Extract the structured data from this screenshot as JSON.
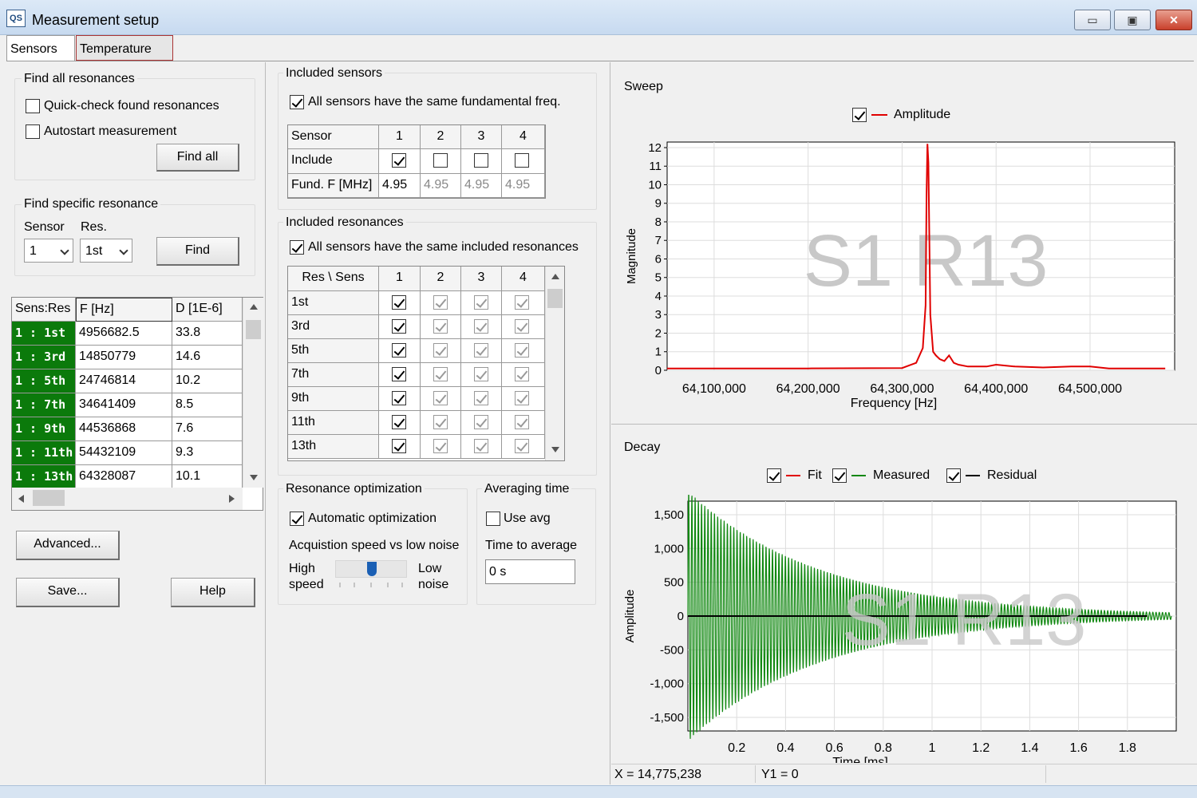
{
  "window": {
    "title": "Measurement setup",
    "icon": "QS",
    "minimize_label": "▭",
    "maximize_label": "▣",
    "close_label": "✕"
  },
  "tabs": [
    {
      "label": "Sensors"
    },
    {
      "label": "Temperature"
    }
  ],
  "find_all": {
    "title": "Find all resonances",
    "quick_check_label": "Quick-check found resonances",
    "quick_check": false,
    "autostart_label": "Autostart measurement",
    "autostart": false,
    "button": "Find all"
  },
  "find_specific": {
    "title": "Find specific resonance",
    "sensor_label": "Sensor",
    "res_label": "Res.",
    "sensor_value": "1",
    "res_value": "1st",
    "button": "Find"
  },
  "results": {
    "columns": [
      "Sens:Res",
      "F [Hz]",
      "D [1E-6]"
    ],
    "rows": [
      {
        "id": "1 : 1st",
        "f": "4956682.5",
        "d": "33.8"
      },
      {
        "id": "1 : 3rd",
        "f": "14850779",
        "d": "14.6"
      },
      {
        "id": "1 : 5th",
        "f": "24746814",
        "d": "10.2"
      },
      {
        "id": "1 : 7th",
        "f": "34641409",
        "d": "8.5"
      },
      {
        "id": "1 : 9th",
        "f": "44536868",
        "d": "7.6"
      },
      {
        "id": "1 : 11th",
        "f": "54432109",
        "d": "9.3"
      },
      {
        "id": "1 : 13th",
        "f": "64328087",
        "d": "10.1"
      }
    ]
  },
  "buttons": {
    "advanced": "Advanced...",
    "save": "Save...",
    "help": "Help"
  },
  "included_sensors": {
    "title": "Included sensors",
    "same_fund_label": "All sensors have the same fundamental freq.",
    "same_fund": true,
    "header": [
      "Sensor",
      "1",
      "2",
      "3",
      "4"
    ],
    "include_label": "Include",
    "include": [
      true,
      false,
      false,
      false
    ],
    "fund_label": "Fund. F [MHz]",
    "fund": [
      "4.95",
      "4.95",
      "4.95",
      "4.95"
    ]
  },
  "included_resonances": {
    "title": "Included resonances",
    "same_res_label": "All sensors have the same included resonances",
    "same_res": true,
    "header": [
      "Res \\ Sens",
      "1",
      "2",
      "3",
      "4"
    ],
    "rows": [
      "1st",
      "3rd",
      "5th",
      "7th",
      "9th",
      "11th",
      "13th"
    ]
  },
  "optimization": {
    "title": "Resonance optimization",
    "auto_label": "Automatic optimization",
    "auto": true,
    "speed_label": "Acquistion speed vs low noise",
    "high_label": "High speed",
    "low_label": "Low noise",
    "slider_level": 0.5
  },
  "averaging": {
    "title": "Averaging time",
    "use_avg_label": "Use avg",
    "use_avg": false,
    "time_label": "Time to average",
    "time_value": "0 s"
  },
  "colors": {
    "fit": "#e00000",
    "measured": "#118811",
    "residual": "#000000",
    "amplitude": "#e00000",
    "highlight": "#0b7a0b"
  },
  "sweep": {
    "title": "Sweep",
    "legend": "Amplitude",
    "watermark": "S1 R13",
    "ylabel": "Magnitude",
    "xlabel": "Frequency [Hz]",
    "yticks": [
      "0",
      "1",
      "2",
      "3",
      "4",
      "5",
      "6",
      "7",
      "8",
      "9",
      "10",
      "11",
      "12"
    ],
    "xticks": [
      "64,100,000",
      "64,200,000",
      "64,300,000",
      "64,400,000",
      "64,500,000"
    ]
  },
  "decay": {
    "title": "Decay",
    "legend_fit": "Fit",
    "legend_measured": "Measured",
    "legend_residual": "Residual",
    "watermark": "S1 R13",
    "ylabel": "Amplitude",
    "xlabel": "Time [ms]",
    "yticks": [
      "1,500",
      "1,000",
      "500",
      "0",
      "-500",
      "-1,000",
      "-1,500"
    ],
    "xticks": [
      "0.2",
      "0.4",
      "0.6",
      "0.8",
      "1",
      "1.2",
      "1.4",
      "1.6",
      "1.8"
    ]
  },
  "status": {
    "x": "X = 14,775,238",
    "y": "Y1 = 0"
  },
  "chart_data": [
    {
      "type": "line",
      "title": "Sweep",
      "xlabel": "Frequency [Hz]",
      "ylabel": "Magnitude",
      "xlim": [
        64050000,
        64590000
      ],
      "ylim": [
        0,
        12.3
      ],
      "series": [
        {
          "name": "Amplitude",
          "x": [
            64050000,
            64200000,
            64300000,
            64315000,
            64322000,
            64325000,
            64326000,
            64327000,
            64328000,
            64330000,
            64333000,
            64336000,
            64340000,
            64345000,
            64350000,
            64355000,
            64360000,
            64370000,
            64390000,
            64400000,
            64420000,
            64450000,
            64480000,
            64500000,
            64520000,
            64580000
          ],
          "y": [
            0.1,
            0.1,
            0.12,
            0.4,
            1.2,
            3.5,
            9.5,
            12.2,
            11.2,
            3.0,
            1.0,
            0.8,
            0.6,
            0.5,
            0.8,
            0.4,
            0.3,
            0.2,
            0.2,
            0.3,
            0.2,
            0.15,
            0.2,
            0.2,
            0.1,
            0.1
          ]
        }
      ]
    },
    {
      "type": "line",
      "title": "Decay",
      "xlabel": "Time [ms]",
      "ylabel": "Amplitude",
      "xlim": [
        0,
        2.0
      ],
      "ylim": [
        -1700,
        1700
      ],
      "series": [
        {
          "name": "Measured",
          "envelope_start": 1850,
          "envelope_end": 50,
          "t_start": 0.0,
          "t_end": 1.98
        },
        {
          "name": "Fit",
          "x": [
            0,
            1.88
          ],
          "y": [
            0,
            0
          ]
        },
        {
          "name": "Residual",
          "x": [
            0,
            1.88
          ],
          "y": [
            0,
            0
          ]
        }
      ]
    }
  ]
}
